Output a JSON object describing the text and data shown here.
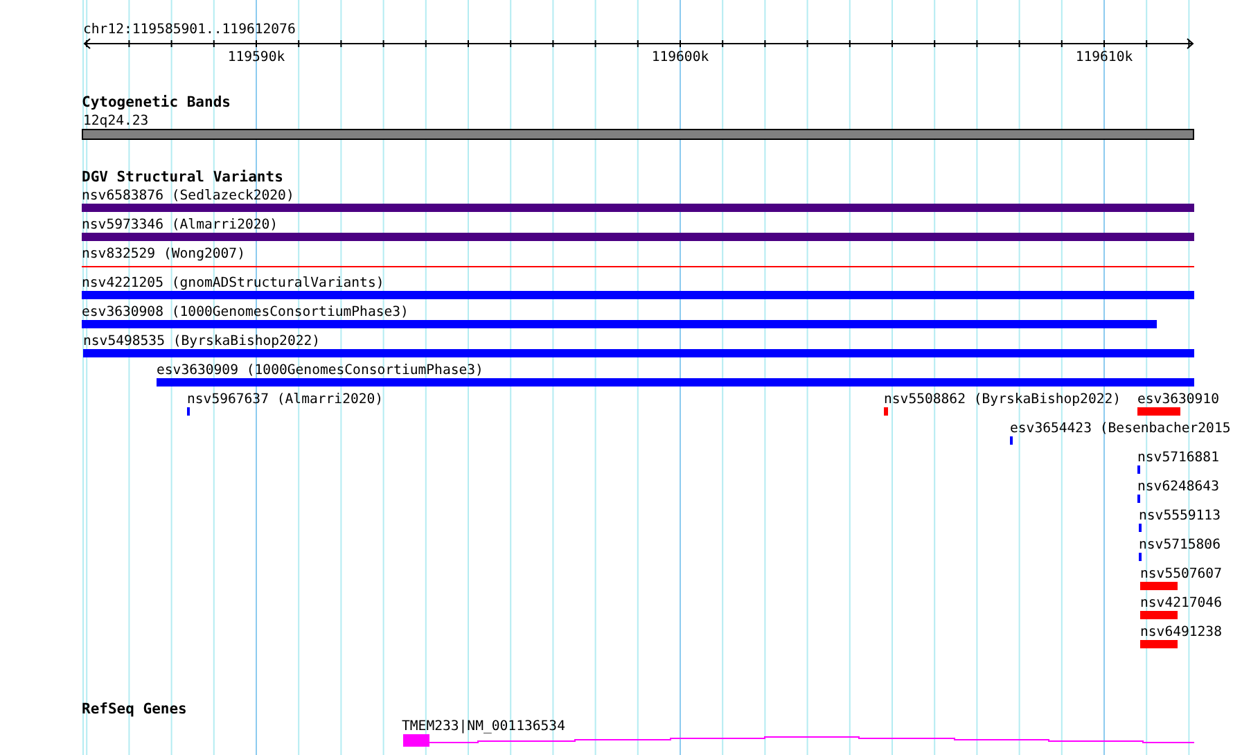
{
  "ruler": {
    "range": "chr12:119585901..119612076",
    "tick_labels": [
      "119590k",
      "119600k",
      "119610k"
    ]
  },
  "tracks": [
    {
      "kind": "bands",
      "title": "Cytogenetic Bands",
      "features": [
        {
          "label": "12q24.23"
        }
      ]
    },
    {
      "kind": "variants",
      "title": "DGV Structural Variants",
      "features": [
        {
          "label": "nsv6583876 (Sedlazeck2020)",
          "color": "#4b0082"
        },
        {
          "label": "nsv5973346 (Almarri2020)",
          "color": "#4b0082"
        },
        {
          "label": "nsv832529 (Wong2007)",
          "color": "#ff0000"
        },
        {
          "label": "nsv4221205 (gnomADStructuralVariants)",
          "color": "#0000ff"
        },
        {
          "label": "esv3630908 (1000GenomesConsortiumPhase3)",
          "color": "#0000ff"
        },
        {
          "label": "nsv5498535 (ByrskaBishop2022)",
          "color": "#0000ff"
        },
        {
          "label": "esv3630909 (1000GenomesConsortiumPhase3)",
          "color": "#0000ff"
        },
        {
          "label": "nsv5967637 (Almarri2020)",
          "color": "#0000ff"
        },
        {
          "label": "nsv5508862 (ByrskaBishop2022)",
          "color": "#ff0000"
        },
        {
          "label": "esv3630910",
          "color": "#ff0000"
        },
        {
          "label": "esv3654423 (Besenbacher2015",
          "color": "#0000ff"
        },
        {
          "label": "nsv5716881",
          "color": "#0000ff"
        },
        {
          "label": "nsv6248643",
          "color": "#0000ff"
        },
        {
          "label": "nsv5559113",
          "color": "#0000ff"
        },
        {
          "label": "nsv5715806",
          "color": "#0000ff"
        },
        {
          "label": "nsv5507607",
          "color": "#ff0000"
        },
        {
          "label": "nsv4217046",
          "color": "#ff0000"
        },
        {
          "label": "nsv6491238",
          "color": "#ff0000"
        }
      ]
    },
    {
      "kind": "genes",
      "title": "RefSeq Genes",
      "features": [
        {
          "label": "TMEM233|NM_001136534"
        }
      ]
    }
  ]
}
